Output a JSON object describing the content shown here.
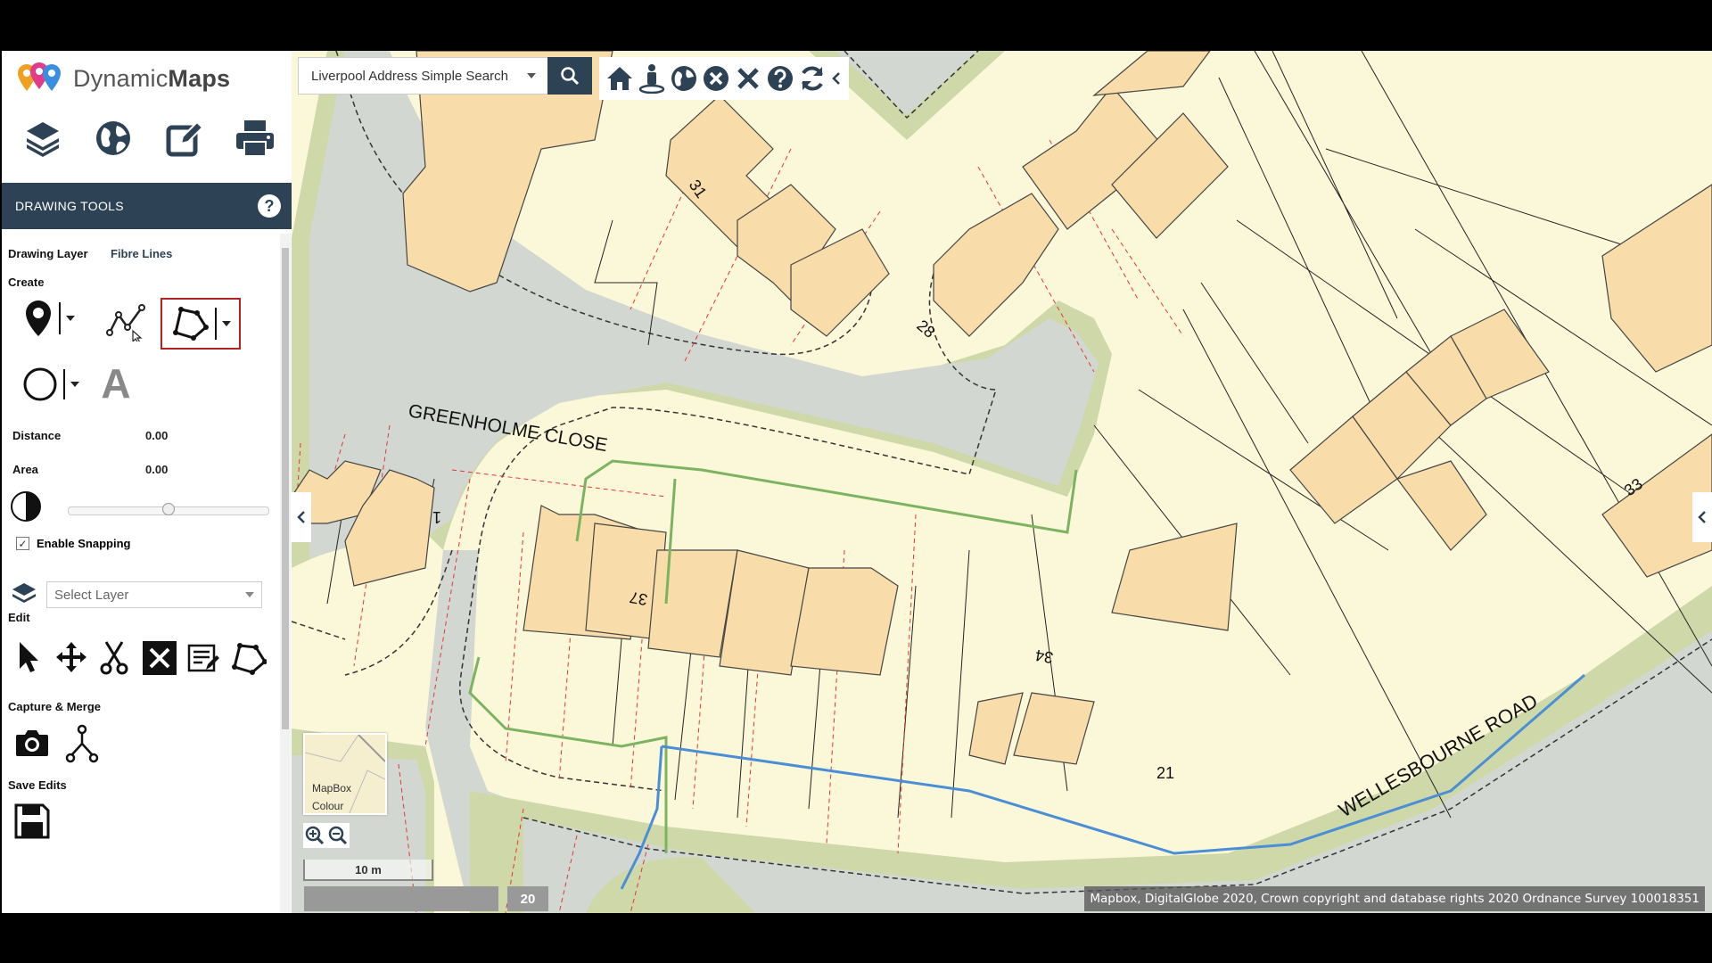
{
  "app": {
    "logo_text_light": "Dynamic",
    "logo_text_bold": "Maps"
  },
  "sidebar": {
    "top_icons": [
      "layers-icon",
      "globe-icon",
      "edit-icon",
      "print-icon"
    ],
    "panel_title": "DRAWING TOOLS",
    "help_label": "?",
    "drawing_layer_label": "Drawing Layer",
    "drawing_layer_value": "Fibre Lines",
    "create_label": "Create",
    "distance_label": "Distance",
    "distance_value": "0.00",
    "area_label": "Area",
    "area_value": "0.00",
    "opacity_level": 0.5,
    "snapping_label": "Enable Snapping",
    "snapping_checked": true,
    "layer_select_placeholder": "Select Layer",
    "edit_label": "Edit",
    "capture_label": "Capture & Merge",
    "save_label": "Save Edits",
    "text_tool_glyph": "A"
  },
  "map": {
    "search_select_value": "Liverpool Address Simple Search",
    "road_labels": {
      "greenholme": "GREENHOLME CLOSE",
      "wellesbourne": "WELLESBOURNE ROAD"
    },
    "house_numbers": {
      "n31": "31",
      "n28": "28",
      "n33": "33",
      "n1": "1",
      "n37": "37",
      "n34": "34",
      "n21": "21"
    },
    "basemap_name_line1": "MapBox",
    "basemap_name_line2": "Colour",
    "scale_label": "10 m",
    "zoom_level": "20",
    "attribution": "Mapbox, DigitalGlobe 2020, Crown copyright and database rights 2020 Ordnance Survey 100018351",
    "colors": {
      "road": "#d0d6cf",
      "verge": "#cfd8a8",
      "land": "#fbf8d9",
      "building": "#f8dcaa",
      "fibre_line": "#4a8fd6",
      "green_line": "#7cb360",
      "header": "#2d4254"
    }
  }
}
